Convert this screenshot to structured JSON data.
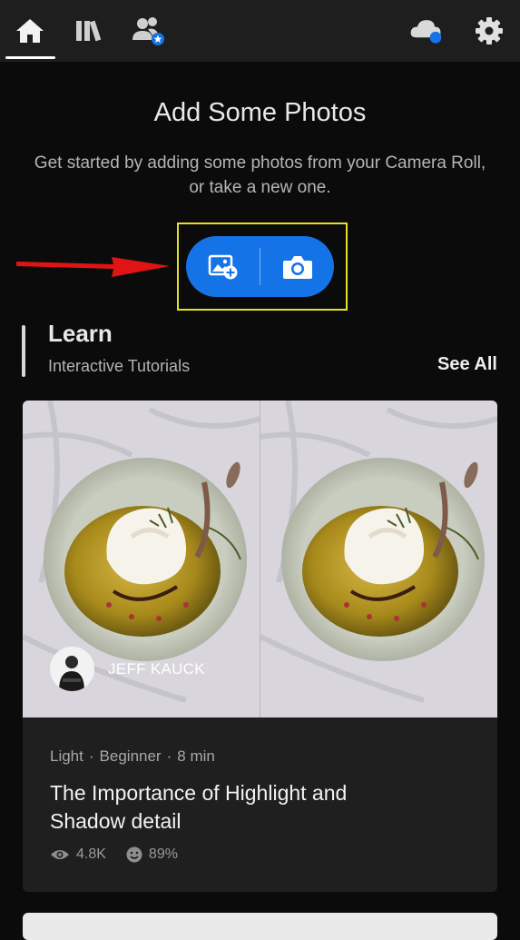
{
  "nav": {
    "tabs": [
      {
        "name": "home",
        "icon": "home-icon",
        "active": true
      },
      {
        "name": "library",
        "icon": "library-icon"
      },
      {
        "name": "people",
        "icon": "people-star-icon"
      }
    ],
    "right_icons": [
      "cloud-sync-icon",
      "gear-icon"
    ],
    "cloud_status_color": "#1473e6"
  },
  "empty_state": {
    "title": "Add Some Photos",
    "subtitle": "Get started by adding some photos from your Camera Roll, or take a new one."
  },
  "add_buttons": {
    "import_icon": "add-photo-icon",
    "camera_icon": "camera-icon",
    "accent": "#1473e6",
    "highlight_color": "#e5e028"
  },
  "learn": {
    "title": "Learn",
    "subtitle": "Interactive Tutorials",
    "see_all": "See All"
  },
  "tutorial": {
    "author": "JEFF KAUCK",
    "category": "Light",
    "level": "Beginner",
    "duration": "8 min",
    "separator": "·",
    "title": "The Importance of Highlight and Shadow detail",
    "views": "4.8K",
    "rating": "89%"
  }
}
